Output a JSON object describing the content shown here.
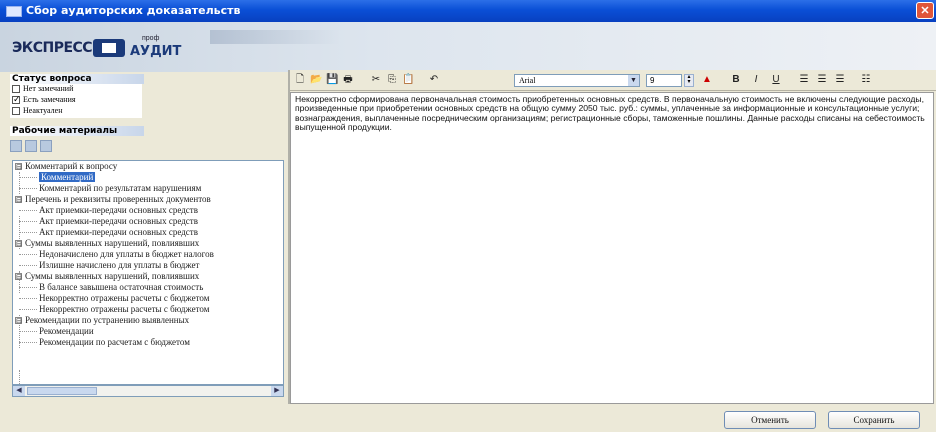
{
  "window": {
    "title": "Сбор аудиторских доказательств",
    "close_glyph": "✕"
  },
  "logo": {
    "main": "ЭКСПРЕСС",
    "prof": "проф",
    "audit": "АУДИТ"
  },
  "status": {
    "header": "Статус вопроса",
    "options": [
      {
        "label": "Нет замечаний",
        "checked": false
      },
      {
        "label": "Есть замечания",
        "checked": true
      },
      {
        "label": "Неактуален",
        "checked": false
      }
    ]
  },
  "work": {
    "header": "Рабочие материалы"
  },
  "tree": {
    "items": [
      {
        "label": "Комментарий к вопросу",
        "level": 0,
        "expander": "⊟"
      },
      {
        "label": "Комментарий",
        "level": 1,
        "selected": true
      },
      {
        "label": "Комментарий по результатам нарушениям",
        "level": 1
      },
      {
        "label": "Перечень и реквизиты проверенных документов",
        "level": 0,
        "expander": "⊟"
      },
      {
        "label": "Акт приемки-передачи основных средств",
        "level": 1
      },
      {
        "label": "Акт приемки-передачи основных средств",
        "level": 1
      },
      {
        "label": "Акт приемки-передачи основных средств",
        "level": 1
      },
      {
        "label": "Суммы выявленных нарушений, повлиявших",
        "level": 0,
        "expander": "⊟"
      },
      {
        "label": "Недоначислено для уплаты в бюджет налогов",
        "level": 1
      },
      {
        "label": "Излишне начислено для уплаты в бюджет",
        "level": 1
      },
      {
        "label": "Суммы выявленных нарушений, повлиявших",
        "level": 0,
        "expander": "⊟"
      },
      {
        "label": "В балансе завышена остаточная стоимость",
        "level": 1
      },
      {
        "label": "Некорректно отражены расчеты с бюджетом",
        "level": 1
      },
      {
        "label": "Некорректно отражены расчеты с бюджетом",
        "level": 1
      },
      {
        "label": "Рекомендации по устранению выявленных",
        "level": 0,
        "expander": "⊟"
      },
      {
        "label": "Рекомендации",
        "level": 1
      },
      {
        "label": "Рекомендации по расчетам с бюджетом",
        "level": 1
      }
    ]
  },
  "editor_toolbar": {
    "font": "Arial",
    "size": "9",
    "bold": "B",
    "italic": "I",
    "underline": "U"
  },
  "editor": {
    "text": "Некорректно сформирована первоначальная стоимость приобретенных основных средств. В первоначальную стоимость не включены следующие расходы, произведенные при приобретении основных средств на общую сумму 2050 тыс. руб.: суммы, уплаченные за информационные и консультационные услуги; вознаграждения, выплаченные посредническим организациям; регистрационные сборы, таможенные пошлины. Данные расходы списаны на себестоимость выпущенной продукции."
  },
  "buttons": {
    "cancel": "Отменить",
    "save": "Сохранить"
  }
}
